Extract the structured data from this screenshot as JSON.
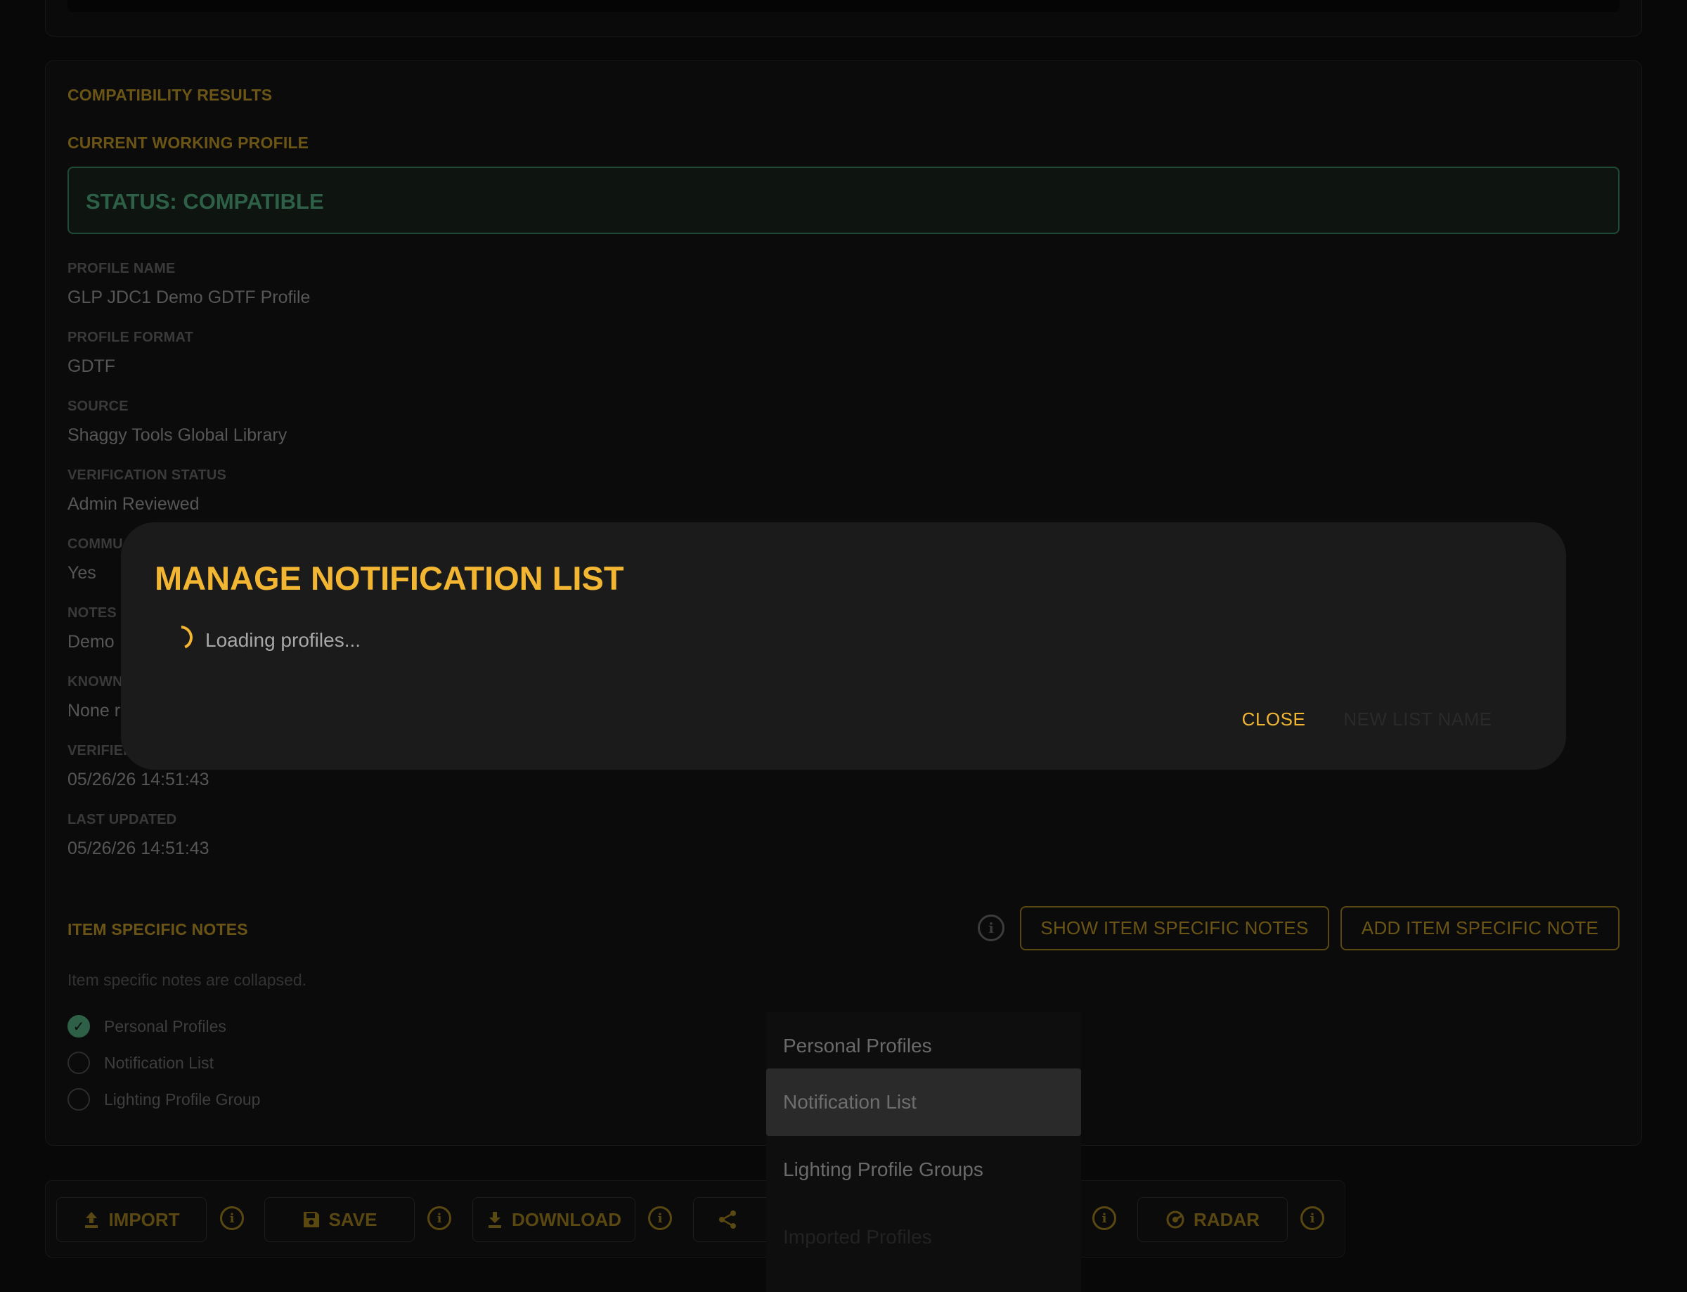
{
  "results": {
    "section_title": "COMPATIBILITY RESULTS",
    "profile_title": "CURRENT WORKING PROFILE",
    "status": "STATUS: COMPATIBLE",
    "fields": [
      {
        "label": "PROFILE NAME",
        "value": "GLP JDC1 Demo GDTF Profile"
      },
      {
        "label": "PROFILE FORMAT",
        "value": "GDTF"
      },
      {
        "label": "SOURCE",
        "value": "Shaggy Tools Global Library"
      },
      {
        "label": "VERIFICATION STATUS",
        "value": "Admin Reviewed"
      },
      {
        "label": "COMMU",
        "value": "Yes"
      },
      {
        "label": "NOTES",
        "value": "Demo"
      },
      {
        "label": "KNOWN",
        "value": "None r"
      },
      {
        "label": "VERIFIEI",
        "value": "05/26/26 14:51:43"
      },
      {
        "label": "LAST UPDATED",
        "value": "05/26/26 14:51:43"
      }
    ]
  },
  "notes": {
    "title": "ITEM SPECIFIC NOTES",
    "show_label": "SHOW ITEM SPECIFIC NOTES",
    "add_label": "ADD ITEM SPECIFIC NOTE",
    "collapsed_text": "Item specific notes are collapsed."
  },
  "lists": [
    {
      "label": "Personal Profiles",
      "checked": true
    },
    {
      "label": "Notification List",
      "checked": false
    },
    {
      "label": "Lighting Profile Group",
      "checked": false
    }
  ],
  "toolbar": {
    "import": "IMPORT",
    "save": "SAVE",
    "download": "DOWNLOAD",
    "radar": "RADAR"
  },
  "dropdown": {
    "items": [
      "Personal Profiles",
      "Notification List",
      "Lighting Profile Groups",
      "Imported Profiles"
    ],
    "selected": "Notification List"
  },
  "modal": {
    "title": "MANAGE NOTIFICATION LIST",
    "loading": "Loading profiles...",
    "close": "CLOSE",
    "secondary": "NEW LIST NAME"
  },
  "colors": {
    "accent": "#f2b632",
    "success": "#2e6047",
    "background": "#080808",
    "modal": "#1b1b1b"
  }
}
